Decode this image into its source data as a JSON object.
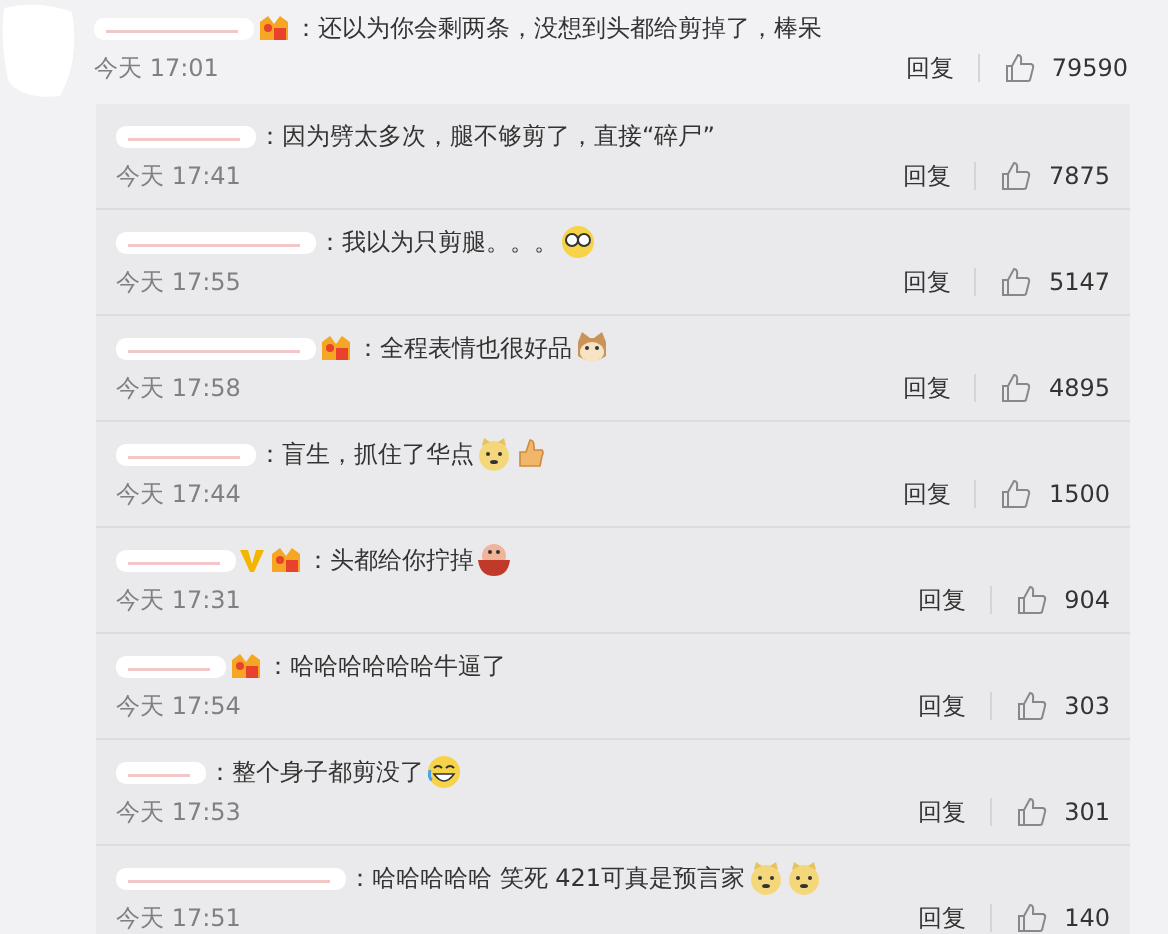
{
  "comment": {
    "text": "：还以为你会剩两条，没想到头都给剪掉了，棒呆",
    "time": "今天 17:01",
    "reply_label": "回复",
    "likes": "79590"
  },
  "replies": [
    {
      "text": "：因为劈太多次，腿不够剪了，直接“碎尸”",
      "time": "今天 17:41",
      "reply_label": "回复",
      "likes": "7875"
    },
    {
      "text": "：我以为只剪腿。。。",
      "time": "今天 17:55",
      "reply_label": "回复",
      "likes": "5147"
    },
    {
      "text": "：全程表情也很好品",
      "time": "今天 17:58",
      "reply_label": "回复",
      "likes": "4895"
    },
    {
      "text": "：盲生，抓住了华点",
      "time": "今天 17:44",
      "reply_label": "回复",
      "likes": "1500"
    },
    {
      "text": "：头都给你拧掉",
      "time": "今天 17:31",
      "reply_label": "回复",
      "likes": "904"
    },
    {
      "text": "：哈哈哈哈哈哈牛逼了",
      "time": "今天 17:54",
      "reply_label": "回复",
      "likes": "303"
    },
    {
      "text": "：整个身子都剪没了",
      "time": "今天 17:53",
      "reply_label": "回复",
      "likes": "301"
    },
    {
      "text": "：哈哈哈哈哈 笑死 421可真是预言家",
      "time": "今天 17:51",
      "reply_label": "回复",
      "likes": "140"
    }
  ]
}
